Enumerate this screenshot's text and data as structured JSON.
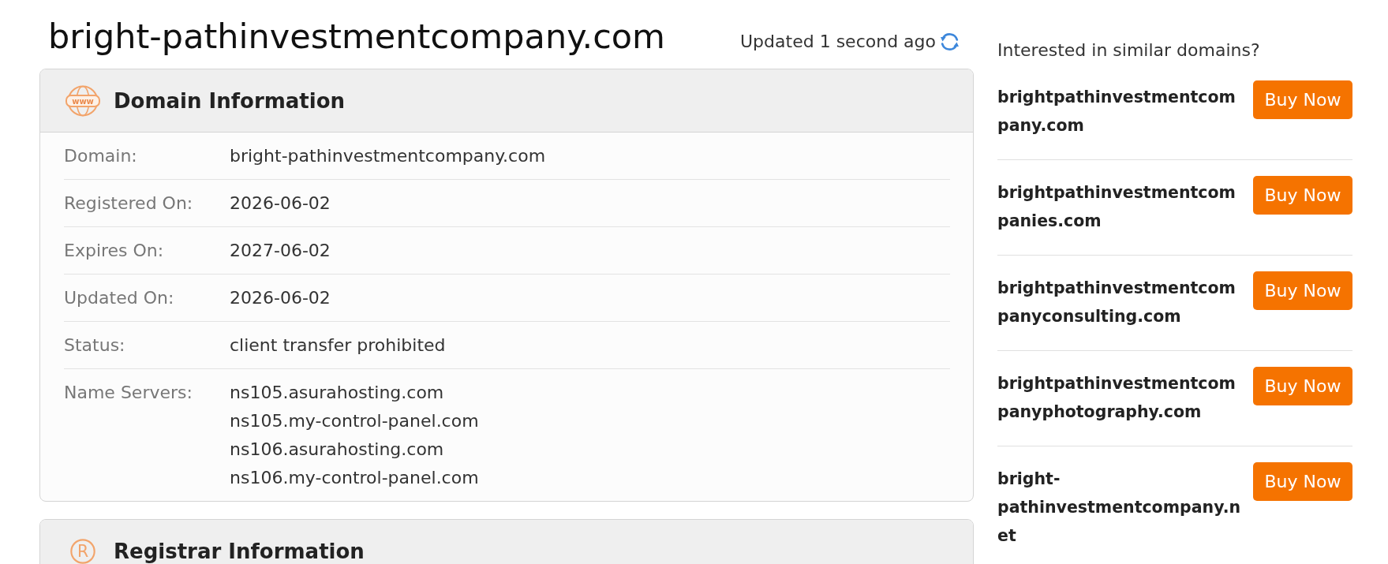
{
  "domain_title": "bright-pathinvestmentcompany.com",
  "updated": "Updated 1 second ago",
  "cards": [
    {
      "kind": "www",
      "icon_label": "www",
      "title": "Domain Information",
      "rows": [
        {
          "label": "Domain:",
          "values": [
            "bright-pathinvestmentcompany.com"
          ]
        },
        {
          "label": "Registered On:",
          "values": [
            "2026-06-02"
          ]
        },
        {
          "label": "Expires On:",
          "values": [
            "2027-06-02"
          ]
        },
        {
          "label": "Updated On:",
          "values": [
            "2026-06-02"
          ]
        },
        {
          "label": "Status:",
          "values": [
            "client transfer prohibited"
          ]
        },
        {
          "label": "Name Servers:",
          "values": [
            "ns105.asurahosting.com",
            "ns105.my-control-panel.com",
            "ns106.asurahosting.com",
            "ns106.my-control-panel.com"
          ]
        }
      ]
    },
    {
      "kind": "registrar",
      "icon_label": "R",
      "title": "Registrar Information"
    }
  ],
  "similar": {
    "heading": "Interested in similar domains?",
    "items": [
      {
        "domain": "brightpathinvestmentcompany.com",
        "button": "Buy Now"
      },
      {
        "domain": "brightpathinvestmentcompanies.com",
        "button": "Buy Now"
      },
      {
        "domain": "brightpathinvestmentcompanyconsulting.com",
        "button": "Buy Now"
      },
      {
        "domain": "brightpathinvestmentcompanyphotography.com",
        "button": "Buy Now"
      },
      {
        "domain": "bright-pathinvestmentcompany.net",
        "button": "Buy Now"
      }
    ]
  }
}
